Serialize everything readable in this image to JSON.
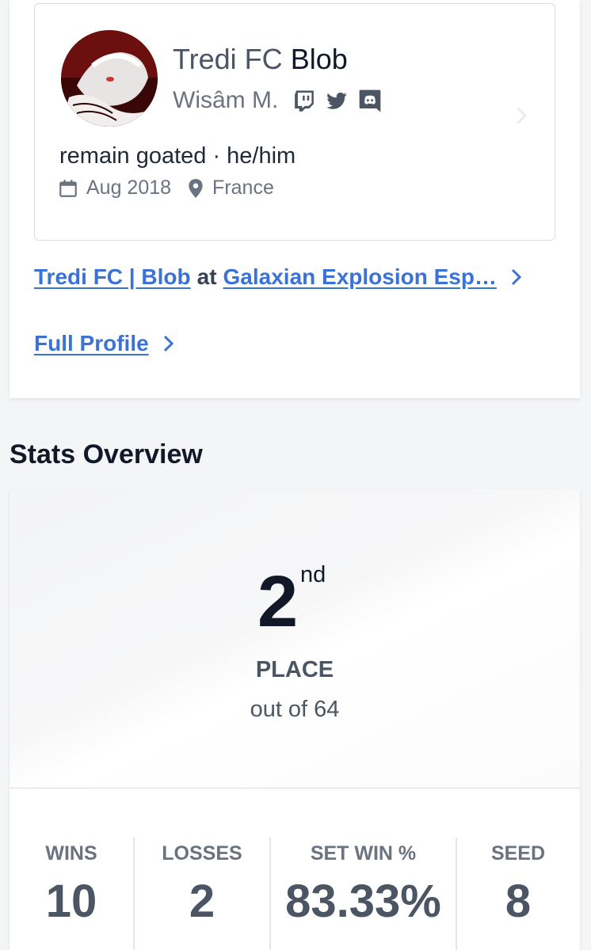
{
  "profile": {
    "name_prefix": "Tredi FC",
    "name_main": "Blob",
    "real_name": "Wisâm M.",
    "social_icons": [
      "twitch-icon",
      "twitter-icon",
      "discord-icon"
    ],
    "bio": "remain goated · he/him",
    "joined": "Aug 2018",
    "location": "France"
  },
  "entrant": {
    "team_player": "Tredi FC | Blob",
    "at": "at",
    "tournament": "Galaxian Explosion Esp…"
  },
  "full_profile_label": "Full Profile",
  "stats": {
    "section_title": "Stats Overview",
    "placement": "2",
    "placement_suffix": "nd",
    "place_label": "PLACE",
    "out_of": "out of 64",
    "items": [
      {
        "label": "WINS",
        "value": "10"
      },
      {
        "label": "LOSSES",
        "value": "2"
      },
      {
        "label": "SET WIN %",
        "value": "83.33%"
      },
      {
        "label": "SEED",
        "value": "8"
      }
    ]
  },
  "colors": {
    "link": "#3a72d6",
    "text_dark": "#111827",
    "text_muted": "#6b7280"
  }
}
